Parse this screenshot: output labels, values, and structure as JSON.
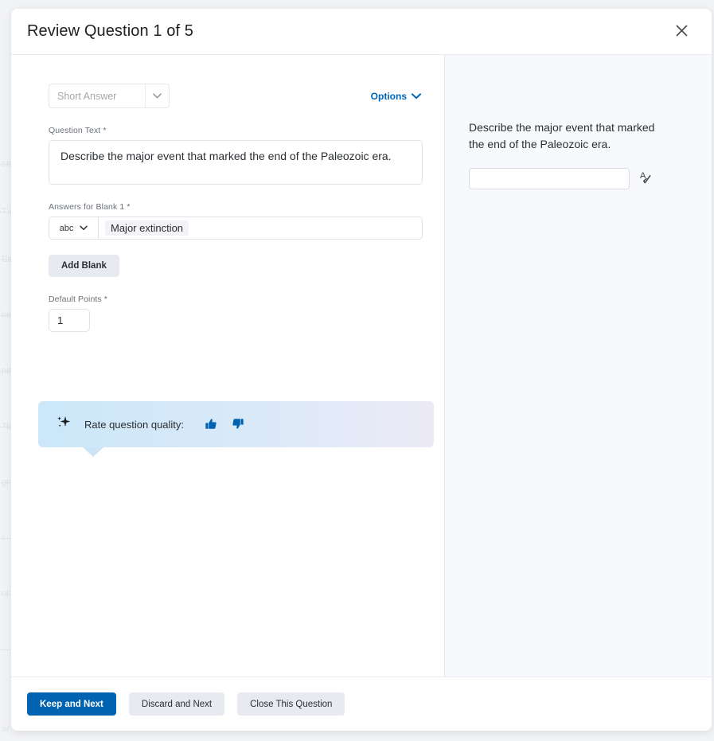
{
  "modal": {
    "title": "Review Question 1 of 5",
    "close_icon": "close-icon"
  },
  "editor": {
    "question_type": {
      "value": "Short Answer",
      "caret_icon": "chevron-down-icon"
    },
    "options_link": {
      "label": "Options",
      "caret_icon": "chevron-down-icon",
      "color": "#0067b8"
    },
    "question_text": {
      "label": "Question Text *",
      "value": "Describe the major event that marked the end of the Paleozoic era."
    },
    "answers": {
      "label": "Answers for Blank 1 *",
      "match_type": "abc",
      "match_caret_icon": "chevron-down-icon",
      "chip_value": "Major extinction"
    },
    "add_blank_label": "Add Blank",
    "default_points": {
      "label": "Default Points *",
      "value": "1"
    },
    "rate_banner": {
      "sparkle_icon": "sparkle-icon",
      "text": "Rate question quality:",
      "thumbs_up_icon": "thumbs-up-icon",
      "thumbs_down_icon": "thumbs-down-icon",
      "accent_color": "#0063b1"
    }
  },
  "preview": {
    "question": "Describe the major event that marked the end of the Paleozoic era.",
    "answer_placeholder": "",
    "spellcheck_icon": "spellcheck-icon"
  },
  "footer": {
    "keep_and_next": "Keep and Next",
    "discard_and_next": "Discard and Next",
    "close_this_question": "Close This Question",
    "primary_color": "#0063b1"
  },
  "background": {
    "ghost_texts": [
      "sm",
      "T a",
      "Ea",
      "be",
      "pe",
      "To",
      "gr",
      "s",
      "or",
      "ar"
    ]
  }
}
